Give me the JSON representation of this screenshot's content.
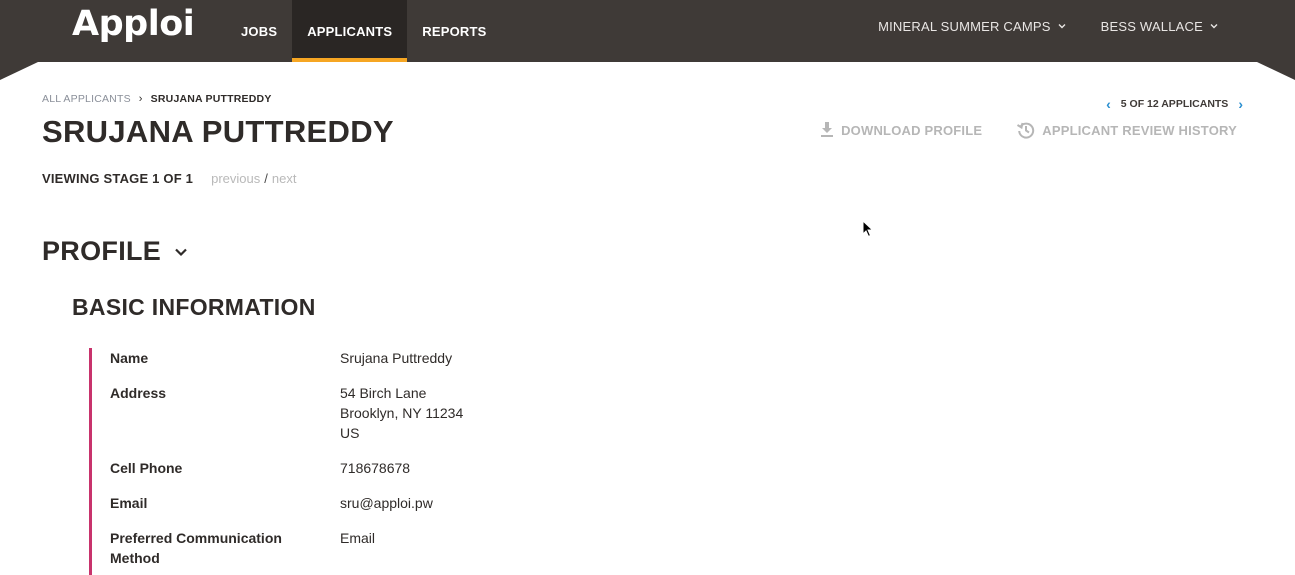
{
  "header": {
    "logo": "Apploi",
    "nav": [
      {
        "label": "JOBS"
      },
      {
        "label": "APPLICANTS"
      },
      {
        "label": "REPORTS"
      }
    ],
    "org_menu": "MINERAL SUMMER CAMPS",
    "user_menu": "BESS WALLACE"
  },
  "breadcrumb": {
    "root": "ALL APPLICANTS",
    "separator": "›",
    "current": "SRUJANA PUTTREDDY"
  },
  "pager": {
    "label": "5 OF 12 APPLICANTS"
  },
  "applicant": {
    "name": "SRUJANA PUTTREDDY"
  },
  "actions": {
    "download": "DOWNLOAD PROFILE",
    "history": "APPLICANT REVIEW HISTORY"
  },
  "stage": {
    "label": "VIEWING STAGE 1 OF 1",
    "previous": "previous",
    "separator": "/",
    "next": "next"
  },
  "profile": {
    "title": "PROFILE",
    "section": "BASIC INFORMATION",
    "fields": [
      {
        "label": "Name",
        "value": [
          "Srujana Puttreddy"
        ]
      },
      {
        "label": "Address",
        "value": [
          "54 Birch Lane",
          "Brooklyn, NY 11234",
          "US"
        ]
      },
      {
        "label": "Cell Phone",
        "value": [
          "718678678"
        ]
      },
      {
        "label": "Email",
        "value": [
          "sru@apploi.pw"
        ]
      },
      {
        "label": "Preferred Communication Method",
        "value": [
          "Email"
        ]
      }
    ]
  },
  "colors": {
    "nav_bg": "#3f3a37",
    "nav_active_underline": "#f6a623",
    "accent_bar": "#c8336c",
    "pager_arrow": "#2a8fd0"
  }
}
